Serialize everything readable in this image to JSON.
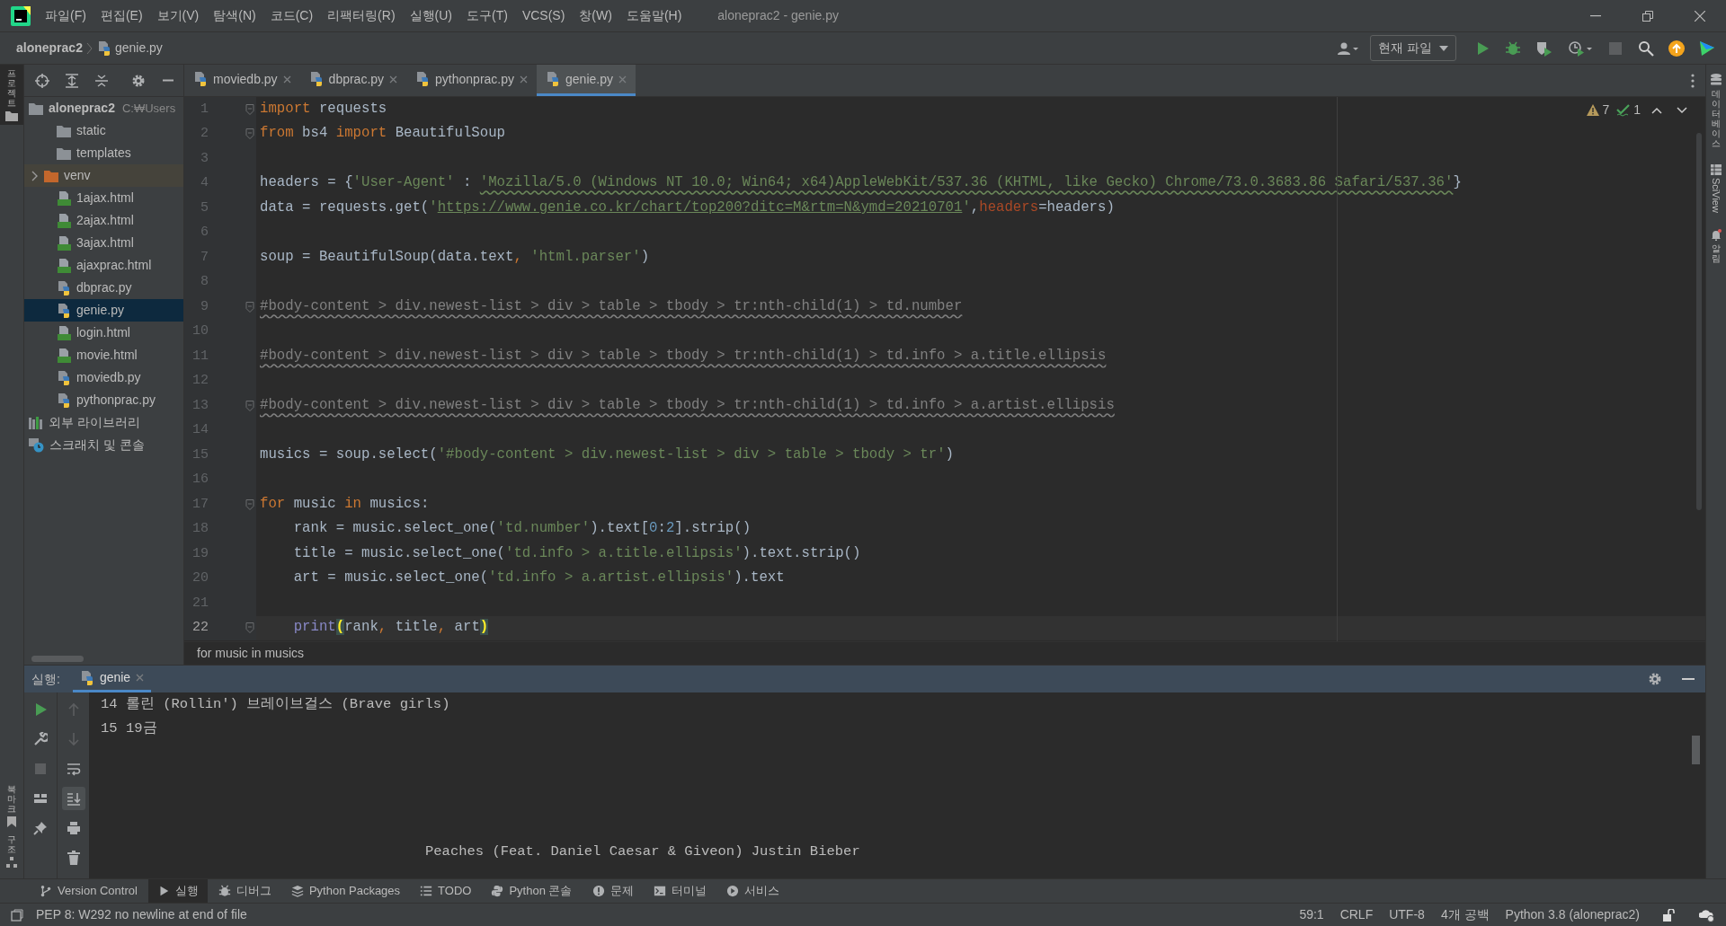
{
  "title_bar": {
    "menu": [
      "파일(F)",
      "편집(E)",
      "보기(V)",
      "탐색(N)",
      "코드(C)",
      "리팩터링(R)",
      "실행(U)",
      "도구(T)",
      "VCS(S)",
      "창(W)",
      "도움말(H)"
    ],
    "title": "aloneprac2 - genie.py"
  },
  "nav_bar": {
    "breadcrumb": [
      {
        "text": "aloneprac2",
        "kind": "project"
      },
      {
        "text": "genie.py",
        "kind": "python"
      }
    ],
    "run_config": "현재 파일"
  },
  "left_strip": {
    "top": [
      "프로젝트"
    ],
    "bottom": [
      "북마크",
      "구조"
    ]
  },
  "right_strip": [
    "데이터베이스",
    "SciView",
    "알림"
  ],
  "project_panel": {
    "tree": [
      {
        "name": "aloneprac2",
        "path": "C:₩Users",
        "kind": "folder",
        "selected": false,
        "children": [
          {
            "name": "static",
            "kind": "folder",
            "selected": false
          },
          {
            "name": "templates",
            "kind": "folder",
            "selected": false
          },
          {
            "name": "venv",
            "kind": "excluded-folder",
            "selected": false
          },
          {
            "name": "1ajax.html",
            "kind": "html",
            "selected": false
          },
          {
            "name": "2ajax.html",
            "kind": "html",
            "selected": false
          },
          {
            "name": "3ajax.html",
            "kind": "html",
            "selected": false
          },
          {
            "name": "ajaxprac.html",
            "kind": "html",
            "selected": false
          },
          {
            "name": "dbprac.py",
            "kind": "python",
            "selected": false
          },
          {
            "name": "genie.py",
            "kind": "python",
            "selected": true
          },
          {
            "name": "login.html",
            "kind": "html",
            "selected": false
          },
          {
            "name": "movie.html",
            "kind": "html",
            "selected": false
          },
          {
            "name": "moviedb.py",
            "kind": "python",
            "selected": false
          },
          {
            "name": "pythonprac.py",
            "kind": "python",
            "selected": false
          }
        ]
      },
      {
        "name": "외부 라이브러리",
        "kind": "library",
        "selected": false
      },
      {
        "name": "스크래치 및 콘솔",
        "kind": "scratch",
        "selected": false
      }
    ]
  },
  "editor": {
    "tabs": [
      {
        "label": "moviedb.py",
        "selected": false
      },
      {
        "label": "dbprac.py",
        "selected": false
      },
      {
        "label": "pythonprac.py",
        "selected": false
      },
      {
        "label": "genie.py",
        "selected": true
      }
    ],
    "inspections": {
      "warnings": "7",
      "weak_warnings": "1"
    },
    "lines": [
      {
        "number": "1",
        "fold": true,
        "current": false,
        "tokens": [
          {
            "kind": "keyword",
            "text": "import"
          },
          {
            "kind": "plain",
            "text": " requests"
          }
        ]
      },
      {
        "number": "2",
        "fold": true,
        "current": false,
        "tokens": [
          {
            "kind": "keyword",
            "text": "from"
          },
          {
            "kind": "plain",
            "text": " bs4 "
          },
          {
            "kind": "keyword",
            "text": "import"
          },
          {
            "kind": "plain",
            "text": " BeautifulSoup"
          }
        ]
      },
      {
        "number": "3",
        "fold": false,
        "current": false
      },
      {
        "number": "4",
        "fold": false,
        "current": false,
        "tokens": [
          {
            "kind": "plain",
            "text": "headers = {"
          },
          {
            "kind": "string",
            "text": "'User-Agent'"
          },
          {
            "kind": "plain",
            "text": " : "
          },
          {
            "kind": "string-warning",
            "text": "'Mozilla/5.0 (Windows NT 10.0; Win64; x64)AppleWebKit/537.36 (KHTML, like Gecko) Chrome/73.0.3683.86 Safari/537.36'"
          },
          {
            "kind": "plain",
            "text": "}"
          }
        ]
      },
      {
        "number": "5",
        "fold": false,
        "current": false,
        "tokens": [
          {
            "kind": "plain",
            "text": "data = requests.get("
          },
          {
            "kind": "string",
            "text": "'"
          },
          {
            "kind": "link",
            "text": "https://www.genie.co.kr/chart/top200?ditc=M&rtm=N&ymd=20210701"
          },
          {
            "kind": "string",
            "text": "'"
          },
          {
            "kind": "plain",
            "text": ","
          },
          {
            "kind": "param",
            "text": "headers"
          },
          {
            "kind": "plain",
            "text": "=headers)"
          }
        ]
      },
      {
        "number": "6",
        "fold": false,
        "current": false
      },
      {
        "number": "7",
        "fold": false,
        "current": false,
        "tokens": [
          {
            "kind": "plain",
            "text": "soup = BeautifulSoup(data.text"
          },
          {
            "kind": "keyword",
            "text": ", "
          },
          {
            "kind": "string",
            "text": "'html.parser'"
          },
          {
            "kind": "plain",
            "text": ")"
          }
        ]
      },
      {
        "number": "8",
        "fold": false,
        "current": false
      },
      {
        "number": "9",
        "fold": true,
        "current": false,
        "tokens": [
          {
            "kind": "comment",
            "text": "#body-content > div.newest-list > div > table > tbody > tr:nth-child(1) > td.number"
          }
        ]
      },
      {
        "number": "10",
        "fold": false,
        "current": false
      },
      {
        "number": "11",
        "fold": false,
        "current": false,
        "tokens": [
          {
            "kind": "comment",
            "text": "#body-content > div.newest-list > div > table > tbody > tr:nth-child(1) > td.info > a.title.ellipsis"
          }
        ]
      },
      {
        "number": "12",
        "fold": false,
        "current": false
      },
      {
        "number": "13",
        "fold": true,
        "current": false,
        "tokens": [
          {
            "kind": "comment",
            "text": "#body-content > div.newest-list > div > table > tbody > tr:nth-child(1) > td.info > a.artist.ellipsis"
          }
        ]
      },
      {
        "number": "14",
        "fold": false,
        "current": false
      },
      {
        "number": "15",
        "fold": false,
        "current": false,
        "tokens": [
          {
            "kind": "plain",
            "text": "musics = soup.select("
          },
          {
            "kind": "string",
            "text": "'#body-content > div.newest-list > div > table > tbody > tr'"
          },
          {
            "kind": "plain",
            "text": ")"
          }
        ]
      },
      {
        "number": "16",
        "fold": false,
        "current": false
      },
      {
        "number": "17",
        "fold": true,
        "current": false,
        "tokens": [
          {
            "kind": "keyword",
            "text": "for"
          },
          {
            "kind": "plain",
            "text": " music "
          },
          {
            "kind": "keyword",
            "text": "in"
          },
          {
            "kind": "plain",
            "text": " musics:"
          }
        ]
      },
      {
        "number": "18",
        "fold": false,
        "current": false,
        "tokens": [
          {
            "kind": "plain",
            "text": "    rank = music.select_one("
          },
          {
            "kind": "string",
            "text": "'td.number'"
          },
          {
            "kind": "plain",
            "text": ").text["
          },
          {
            "kind": "number",
            "text": "0"
          },
          {
            "kind": "plain",
            "text": ":"
          },
          {
            "kind": "number",
            "text": "2"
          },
          {
            "kind": "plain",
            "text": "].strip()"
          }
        ]
      },
      {
        "number": "19",
        "fold": false,
        "current": false,
        "tokens": [
          {
            "kind": "plain",
            "text": "    title = music.select_one("
          },
          {
            "kind": "string",
            "text": "'td.info > a.title.ellipsis'"
          },
          {
            "kind": "plain",
            "text": ").text.strip()"
          }
        ]
      },
      {
        "number": "20",
        "fold": false,
        "current": false,
        "tokens": [
          {
            "kind": "plain",
            "text": "    art = music.select_one("
          },
          {
            "kind": "string",
            "text": "'td.info > a.artist.ellipsis'"
          },
          {
            "kind": "plain",
            "text": ").text"
          }
        ]
      },
      {
        "number": "21",
        "fold": false,
        "current": false
      },
      {
        "number": "22",
        "fold": true,
        "current": true,
        "tokens": [
          {
            "kind": "builtin",
            "text": "    print"
          },
          {
            "kind": "brace",
            "text": "("
          },
          {
            "kind": "plain",
            "text": "rank"
          },
          {
            "kind": "keyword",
            "text": ","
          },
          {
            "kind": "plain",
            "text": " title"
          },
          {
            "kind": "keyword",
            "text": ","
          },
          {
            "kind": "plain",
            "text": " art"
          },
          {
            "kind": "brace",
            "text": ")"
          }
        ]
      }
    ],
    "breadcrumb": "for music in musics"
  },
  "run_panel": {
    "label": "실행:",
    "tabs": [
      {
        "label": "genie",
        "selected": true
      }
    ],
    "output": [
      {
        "kind": "line",
        "text": "14 롤린 (Rollin') 브레이브걸스 (Brave girls)"
      },
      {
        "kind": "line",
        "text": "15 19금"
      },
      {
        "kind": "wrapped",
        "text": "Peaches (Feat. Daniel Caesar & Giveon) Justin Bieber"
      }
    ]
  },
  "tool_windows": [
    {
      "label": "Version Control",
      "kind": "vcs",
      "selected": false
    },
    {
      "label": "실행",
      "kind": "run",
      "selected": true
    },
    {
      "label": "디버그",
      "kind": "debug",
      "selected": false
    },
    {
      "label": "Python Packages",
      "kind": "packages",
      "selected": false
    },
    {
      "label": "TODO",
      "kind": "todo",
      "selected": false
    },
    {
      "label": "Python 콘솔",
      "kind": "console",
      "selected": false
    },
    {
      "label": "문제",
      "kind": "problems",
      "selected": false
    },
    {
      "label": "터미널",
      "kind": "terminal",
      "selected": false
    },
    {
      "label": "서비스",
      "kind": "services",
      "selected": false
    }
  ],
  "status_bar": {
    "message": "PEP 8: W292 no newline at end of file",
    "items": [
      "59:1",
      "CRLF",
      "UTF-8",
      "4개 공백",
      "Python 3.8 (aloneprac2)"
    ]
  }
}
